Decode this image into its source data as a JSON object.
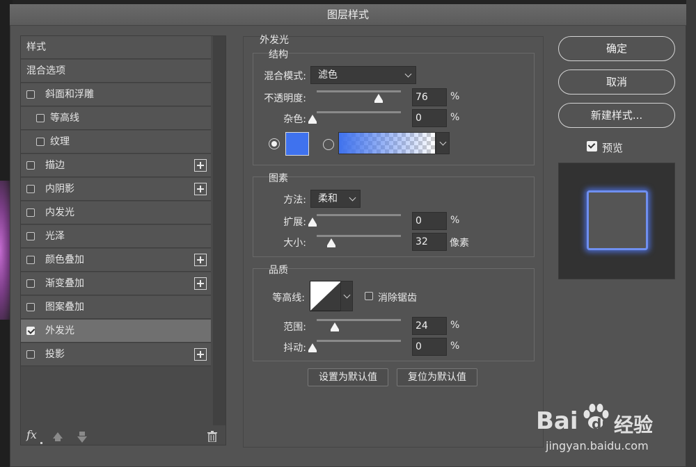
{
  "window": {
    "title": "图层样式"
  },
  "styles_list": {
    "items": [
      {
        "label": "样式",
        "kind": "header"
      },
      {
        "label": "混合选项",
        "kind": "header"
      },
      {
        "label": "斜面和浮雕",
        "checked": false,
        "plus": false
      },
      {
        "label": "等高线",
        "checked": false,
        "plus": false,
        "indent": true
      },
      {
        "label": "纹理",
        "checked": false,
        "plus": false,
        "indent": true
      },
      {
        "label": "描边",
        "checked": false,
        "plus": true
      },
      {
        "label": "内阴影",
        "checked": false,
        "plus": true
      },
      {
        "label": "内发光",
        "checked": false,
        "plus": false
      },
      {
        "label": "光泽",
        "checked": false,
        "plus": false
      },
      {
        "label": "颜色叠加",
        "checked": false,
        "plus": true
      },
      {
        "label": "渐变叠加",
        "checked": false,
        "plus": true
      },
      {
        "label": "图案叠加",
        "checked": false,
        "plus": false
      },
      {
        "label": "外发光",
        "checked": true,
        "plus": false,
        "selected": true
      },
      {
        "label": "投影",
        "checked": false,
        "plus": true
      }
    ],
    "footer": {
      "fx_label": "fx"
    }
  },
  "outer_glow": {
    "title": "外发光",
    "structure": {
      "title": "结构",
      "blend_mode_label": "混合模式:",
      "blend_mode_value": "滤色",
      "opacity_label": "不透明度:",
      "opacity_value": "76",
      "opacity_unit": "%",
      "opacity_level": 0.76,
      "noise_label": "杂色:",
      "noise_value": "0",
      "noise_unit": "%",
      "noise_level": 0,
      "glow_color": "#3f72ee",
      "color_mode": "solid"
    },
    "elements": {
      "title": "图素",
      "technique_label": "方法:",
      "technique_value": "柔和",
      "spread_label": "扩展:",
      "spread_value": "0",
      "spread_unit": "%",
      "spread_level": 0,
      "size_label": "大小:",
      "size_value": "32",
      "size_unit": "像素",
      "size_level": 0.2
    },
    "quality": {
      "title": "品质",
      "contour_label": "等高线:",
      "antialias_label": "消除锯齿",
      "antialias_checked": false,
      "range_label": "范围:",
      "range_value": "24",
      "range_unit": "%",
      "range_level": 0.24,
      "jitter_label": "抖动:",
      "jitter_value": "0",
      "jitter_unit": "%",
      "jitter_level": 0
    },
    "buttons": {
      "make_default": "设置为默认值",
      "reset_default": "复位为默认值"
    }
  },
  "actions": {
    "ok": "确定",
    "cancel": "取消",
    "new_style": "新建样式...",
    "preview_label": "预览",
    "preview_checked": true
  },
  "watermark": {
    "brand": "Bai",
    "brand2": "du",
    "product": "经验",
    "url": "jingyan.baidu.com"
  }
}
